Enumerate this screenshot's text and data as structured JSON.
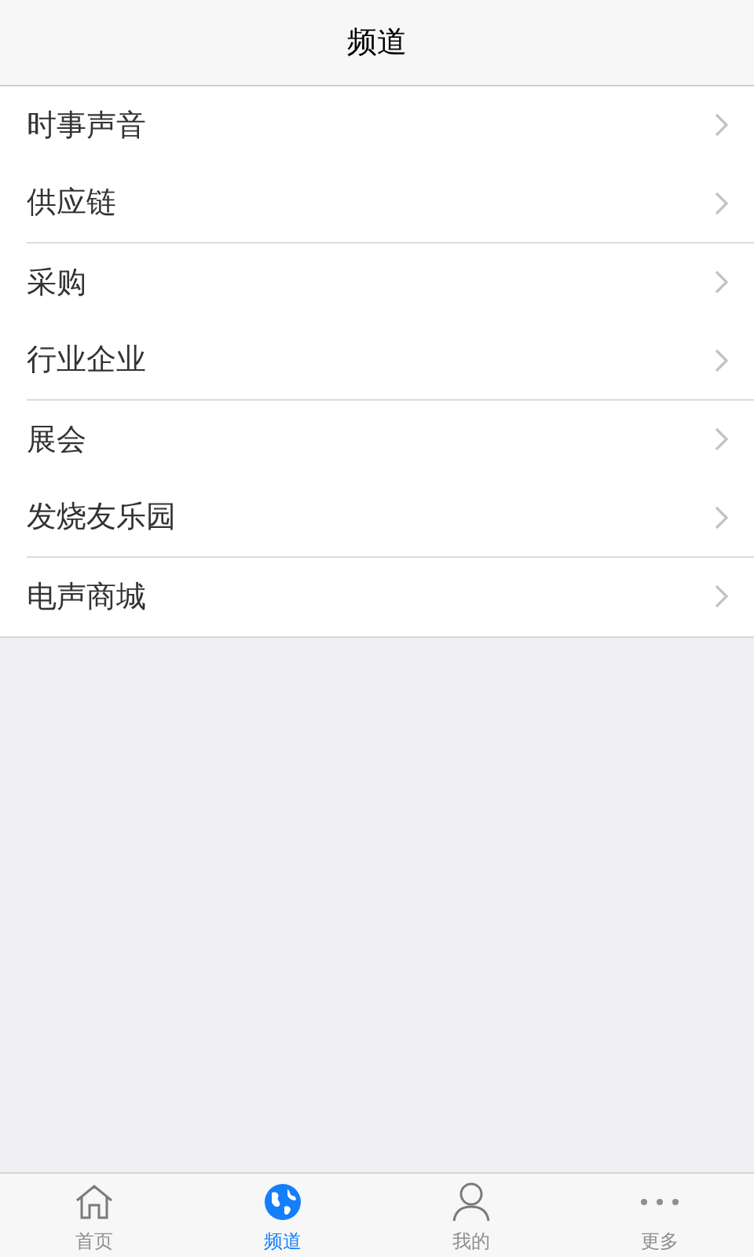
{
  "header": {
    "title": "频道"
  },
  "groups": [
    {
      "items": [
        "时事声音",
        "供应链"
      ]
    },
    {
      "items": [
        "采购",
        "行业企业"
      ]
    },
    {
      "items": [
        "展会",
        "发烧友乐园"
      ]
    },
    {
      "items": [
        "电声商城"
      ]
    }
  ],
  "tabs": [
    {
      "label": "首页",
      "kind": "home",
      "selected": false
    },
    {
      "label": "频道",
      "kind": "globe",
      "selected": true
    },
    {
      "label": "我的",
      "kind": "person",
      "selected": false
    },
    {
      "label": "更多",
      "kind": "more",
      "selected": false
    }
  ]
}
